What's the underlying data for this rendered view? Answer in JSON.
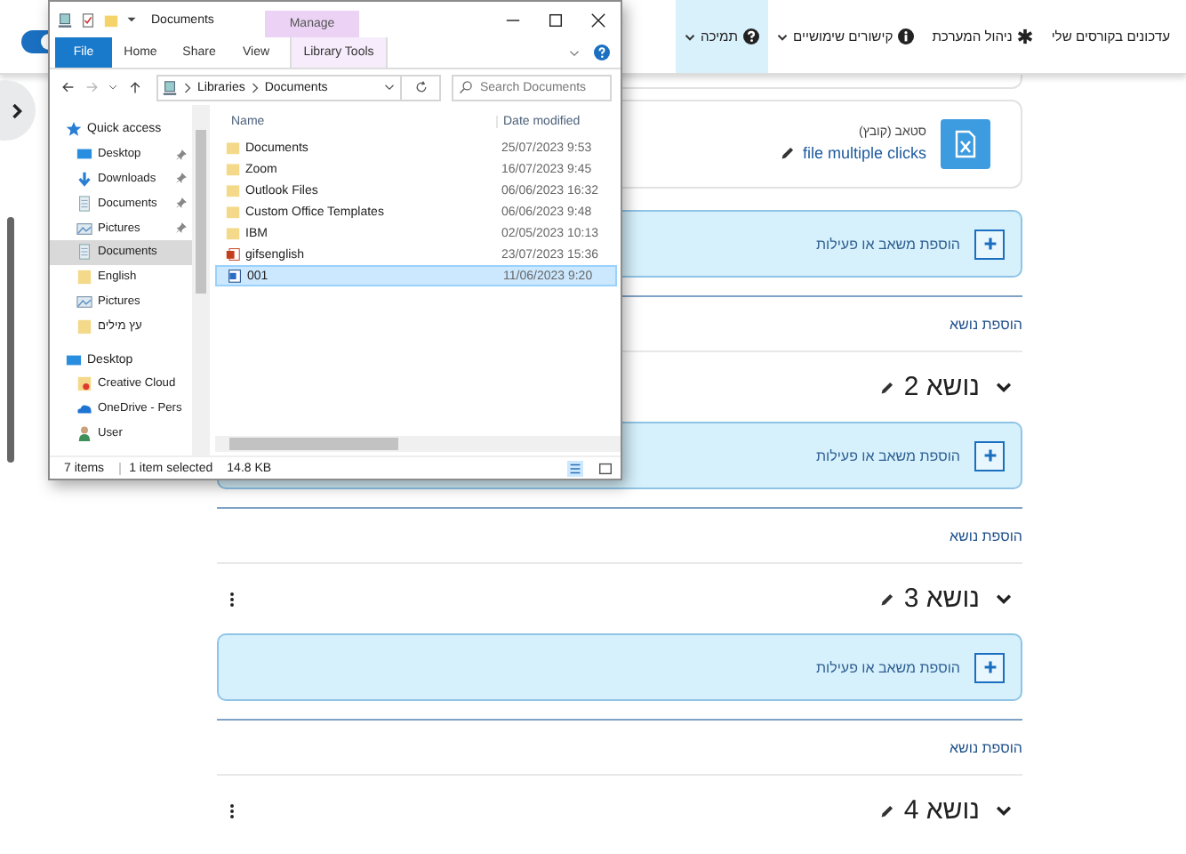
{
  "edit_toggle": {
    "on": true
  },
  "navbar": {
    "items": [
      {
        "kind": "plain",
        "label": "עדכונים בקורסים שלי",
        "dropdown": false,
        "selected": false
      },
      {
        "kind": "admin",
        "label": "ניהול המערכת",
        "dropdown": false,
        "selected": false
      },
      {
        "kind": "links",
        "label": "קישורים שימושיים",
        "dropdown": true,
        "selected": false
      },
      {
        "kind": "help",
        "label": "תמיכה",
        "dropdown": true,
        "selected": true
      }
    ]
  },
  "course": {
    "sections": [
      {
        "activities": [
          {
            "type": "סטאב (קובץ)",
            "name": "file multiple clicks"
          }
        ],
        "add_activity": "הוספת משאב או פעילות",
        "add_topic": "הוספת נושא"
      },
      {
        "title": "נושא 2",
        "add_activity": "הוספת משאב או פעילות",
        "add_topic": "הוספת נושא"
      },
      {
        "title": "נושא 3",
        "add_activity": "הוספת משאב או פעילות",
        "add_topic": "הוספת נושא"
      },
      {
        "title": "נושא 4"
      }
    ]
  },
  "explorer": {
    "title": "Documents",
    "context_group": "Manage",
    "ribbon_tabs": [
      {
        "label": "File",
        "kind": "file"
      },
      {
        "label": "Home",
        "kind": "tab"
      },
      {
        "label": "Share",
        "kind": "tab"
      },
      {
        "label": "View",
        "kind": "tab"
      },
      {
        "label": "Library Tools",
        "kind": "context"
      }
    ],
    "path": [
      "Libraries",
      "Documents"
    ],
    "search": {
      "placeholder": "Search Documents"
    },
    "nav": [
      {
        "label": "Quick access",
        "kind": "star",
        "selected": false,
        "children": [
          {
            "label": "Desktop",
            "kind": "desktop",
            "pinned": true,
            "selected": false
          },
          {
            "label": "Downloads",
            "kind": "download",
            "pinned": true,
            "selected": false
          },
          {
            "label": "Documents",
            "kind": "docs",
            "pinned": true,
            "selected": false
          },
          {
            "label": "Pictures",
            "kind": "pictures",
            "pinned": true,
            "selected": false
          },
          {
            "label": "Documents",
            "kind": "docs",
            "pinned": false,
            "selected": true
          },
          {
            "label": "English",
            "kind": "folder",
            "pinned": false,
            "selected": false
          },
          {
            "label": "Pictures",
            "kind": "pictures",
            "pinned": false,
            "selected": false
          },
          {
            "label": "עץ מילים",
            "kind": "folder",
            "pinned": false,
            "selected": false
          }
        ]
      },
      {
        "label": "Desktop",
        "kind": "desktop",
        "selected": false,
        "children": [
          {
            "label": "Creative Cloud",
            "kind": "cloud-folder",
            "pinned": false,
            "selected": false
          },
          {
            "label": "OneDrive - Pers",
            "kind": "onedrive",
            "pinned": false,
            "selected": false
          },
          {
            "label": "User",
            "kind": "user",
            "pinned": false,
            "selected": false
          }
        ]
      }
    ],
    "columns": [
      "Name",
      "Date modified"
    ],
    "files": [
      {
        "name": "Documents",
        "date": "25/07/2023 9:53",
        "kind": "folder",
        "selected": false
      },
      {
        "name": "Zoom",
        "date": "16/07/2023 9:45",
        "kind": "folder",
        "selected": false
      },
      {
        "name": "Outlook Files",
        "date": "06/06/2023 16:32",
        "kind": "folder",
        "selected": false
      },
      {
        "name": "Custom Office Templates",
        "date": "06/06/2023 9:48",
        "kind": "folder",
        "selected": false
      },
      {
        "name": "IBM",
        "date": "02/05/2023 10:13",
        "kind": "folder",
        "selected": false
      },
      {
        "name": "gifsenglish",
        "date": "23/07/2023 15:36",
        "kind": "slides",
        "selected": false
      },
      {
        "name": "001",
        "date": "11/06/2023 9:20",
        "kind": "doc",
        "selected": true
      }
    ],
    "status": {
      "count": "7 items",
      "selection": "1 item selected",
      "size": "14.8 KB"
    }
  }
}
